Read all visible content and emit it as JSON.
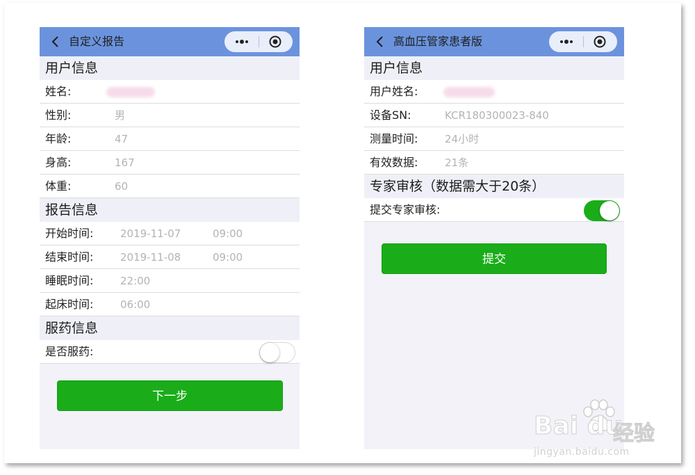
{
  "left": {
    "nav_title": "自定义报告",
    "sections": [
      {
        "title": "用户信息",
        "rows": [
          {
            "label": "姓名:",
            "value": ""
          },
          {
            "label": "性别:",
            "value": "男"
          },
          {
            "label": "年龄:",
            "value": "47"
          },
          {
            "label": "身高:",
            "value": "167"
          },
          {
            "label": "体重:",
            "value": "60"
          }
        ]
      },
      {
        "title": "报告信息",
        "rows": [
          {
            "label": "开始时间:",
            "date": "2019-11-07",
            "time": "09:00"
          },
          {
            "label": "结束时间:",
            "date": "2019-11-08",
            "time": "09:00"
          },
          {
            "label": "睡眠时间:",
            "value": "22:00"
          },
          {
            "label": "起床时间:",
            "value": "06:00"
          }
        ]
      },
      {
        "title": "服药信息",
        "rows": [
          {
            "label": "是否服药:",
            "toggle": false
          }
        ]
      }
    ],
    "button": "下一步"
  },
  "right": {
    "nav_title": "高血压管家患者版",
    "sections": [
      {
        "title": "用户信息",
        "rows": [
          {
            "label": "用户姓名:",
            "value": ""
          },
          {
            "label": "设备SN:",
            "value": "KCR180300023-840"
          },
          {
            "label": "测量时间:",
            "value": "24小时"
          },
          {
            "label": "有效数据:",
            "value": "21条"
          }
        ]
      },
      {
        "title": "专家审核（数据需大于20条）",
        "rows": [
          {
            "label": "提交专家审核:",
            "toggle": true
          }
        ]
      }
    ],
    "button": "提交"
  },
  "watermark": {
    "brand": "Bai du",
    "cn": "经验",
    "url": "jingyan.baidu.com"
  },
  "colors": {
    "navbar": "#6b93dd",
    "primary_button": "#1aad19",
    "page_bg": "#f2f2f8",
    "value_text": "#b3b3b3"
  }
}
